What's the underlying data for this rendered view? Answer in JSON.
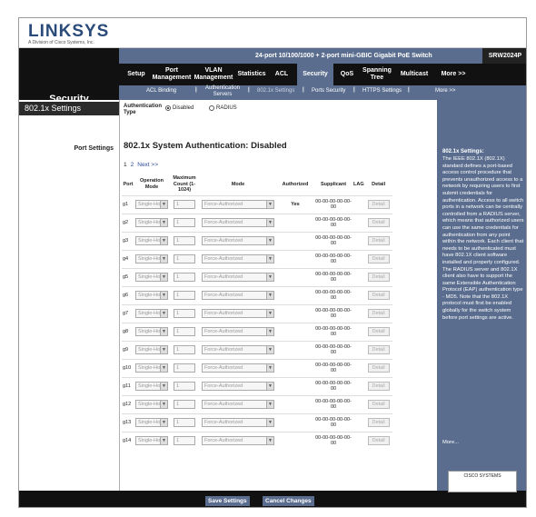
{
  "brand": {
    "logo": "LINKSYS",
    "logo_sub": "A Division of Cisco Systems, Inc.",
    "cisco": "CISCO SYSTEMS"
  },
  "header": {
    "product": "24-port 10/100/1000 + 2-port mini-GBIC Gigabit PoE Switch",
    "model": "SRW2024P",
    "section": "Security"
  },
  "nav": [
    {
      "label": "Setup"
    },
    {
      "label": "Port Management"
    },
    {
      "label": "VLAN Management"
    },
    {
      "label": "Statistics"
    },
    {
      "label": "ACL"
    },
    {
      "label": "Security",
      "active": true
    },
    {
      "label": "QoS"
    },
    {
      "label": "Spanning Tree"
    },
    {
      "label": "Multicast"
    },
    {
      "label": "More >>"
    }
  ],
  "subnav": [
    {
      "label": "ACL Binding"
    },
    {
      "label": "Authentication Servers"
    },
    {
      "label": "802.1x Settings",
      "active": true
    },
    {
      "label": "Ports Security"
    },
    {
      "label": "HTTPS Settings"
    },
    {
      "label": "More >>"
    }
  ],
  "left": {
    "heading": "802.1x Settings",
    "port_settings": "Port Settings"
  },
  "auth": {
    "label": "Authentication Type",
    "options": [
      "Disabled",
      "RADIUS"
    ],
    "selected": "Disabled"
  },
  "status_text": "802.1x System Authentication: Disabled",
  "pager": {
    "pages": [
      "1",
      "2"
    ],
    "next": "Next >>"
  },
  "table": {
    "headers": {
      "port": "Port",
      "operation_mode": "Operation Mode",
      "max_count": "Maximum Count (1-1024)",
      "mode": "Mode",
      "authorized": "Authorized",
      "supplicant": "Supplicant",
      "lag": "LAG",
      "detail": "Detail"
    },
    "rows": [
      {
        "port": "g1",
        "op": "Single-Host",
        "count": "1",
        "mode": "Force-Authorized",
        "auth": "Yes",
        "supp": "00-00-00-00-00-00",
        "detail": "Detail"
      },
      {
        "port": "g2",
        "op": "Single-Host",
        "count": "1",
        "mode": "Force-Authorized",
        "auth": "",
        "supp": "00-00-00-00-00-00",
        "detail": "Detail"
      },
      {
        "port": "g3",
        "op": "Single-Host",
        "count": "1",
        "mode": "Force-Authorized",
        "auth": "",
        "supp": "00-00-00-00-00-00",
        "detail": "Detail"
      },
      {
        "port": "g4",
        "op": "Single-Host",
        "count": "1",
        "mode": "Force-Authorized",
        "auth": "",
        "supp": "00-00-00-00-00-00",
        "detail": "Detail"
      },
      {
        "port": "g5",
        "op": "Single-Host",
        "count": "1",
        "mode": "Force-Authorized",
        "auth": "",
        "supp": "00-00-00-00-00-00",
        "detail": "Detail"
      },
      {
        "port": "g6",
        "op": "Single-Host",
        "count": "1",
        "mode": "Force-Authorized",
        "auth": "",
        "supp": "00-00-00-00-00-00",
        "detail": "Detail"
      },
      {
        "port": "g7",
        "op": "Single-Host",
        "count": "1",
        "mode": "Force-Authorized",
        "auth": "",
        "supp": "00-00-00-00-00-00",
        "detail": "Detail"
      },
      {
        "port": "g8",
        "op": "Single-Host",
        "count": "1",
        "mode": "Force-Authorized",
        "auth": "",
        "supp": "00-00-00-00-00-00",
        "detail": "Detail"
      },
      {
        "port": "g9",
        "op": "Single-Host",
        "count": "1",
        "mode": "Force-Authorized",
        "auth": "",
        "supp": "00-00-00-00-00-00",
        "detail": "Detail"
      },
      {
        "port": "g10",
        "op": "Single-Host",
        "count": "1",
        "mode": "Force-Authorized",
        "auth": "",
        "supp": "00-00-00-00-00-00",
        "detail": "Detail"
      },
      {
        "port": "g11",
        "op": "Single-Host",
        "count": "1",
        "mode": "Force-Authorized",
        "auth": "",
        "supp": "00-00-00-00-00-00",
        "detail": "Detail"
      },
      {
        "port": "g12",
        "op": "Single-Host",
        "count": "1",
        "mode": "Force-Authorized",
        "auth": "",
        "supp": "00-00-00-00-00-00",
        "detail": "Detail"
      },
      {
        "port": "g13",
        "op": "Single-Host",
        "count": "1",
        "mode": "Force-Authorized",
        "auth": "",
        "supp": "00-00-00-00-00-00",
        "detail": "Detail"
      },
      {
        "port": "g14",
        "op": "Single-Host",
        "count": "1",
        "mode": "Force-Authorized",
        "auth": "",
        "supp": "00-00-00-00-00-00",
        "detail": "Detail"
      }
    ]
  },
  "help": {
    "title": "802.1x Settings:",
    "body": "The IEEE 802.1X (802.1X) standard defines a port-based access control procedure that prevents unauthorized access to a network by requiring users to first submit credentials for authentication. Access to all switch ports in a network can be centrally controlled from a RADIUS server, which means that authorized users can use the same credentials for authentication from any point within the network. Each client that needs to be authenticated must have 802.1X client software installed and properly configured. The RADIUS server and 802.1X client also have to support the same Extensible Authentication Protocol (EAP) authentication type - MD5. Note that the 802.1X protocol must first be enabled globally for the switch system before port settings are active.",
    "more": "More..."
  },
  "footer": {
    "save": "Save Settings",
    "cancel": "Cancel Changes"
  },
  "colors": {
    "accent": "#5a6d8e",
    "dark": "#111111"
  }
}
